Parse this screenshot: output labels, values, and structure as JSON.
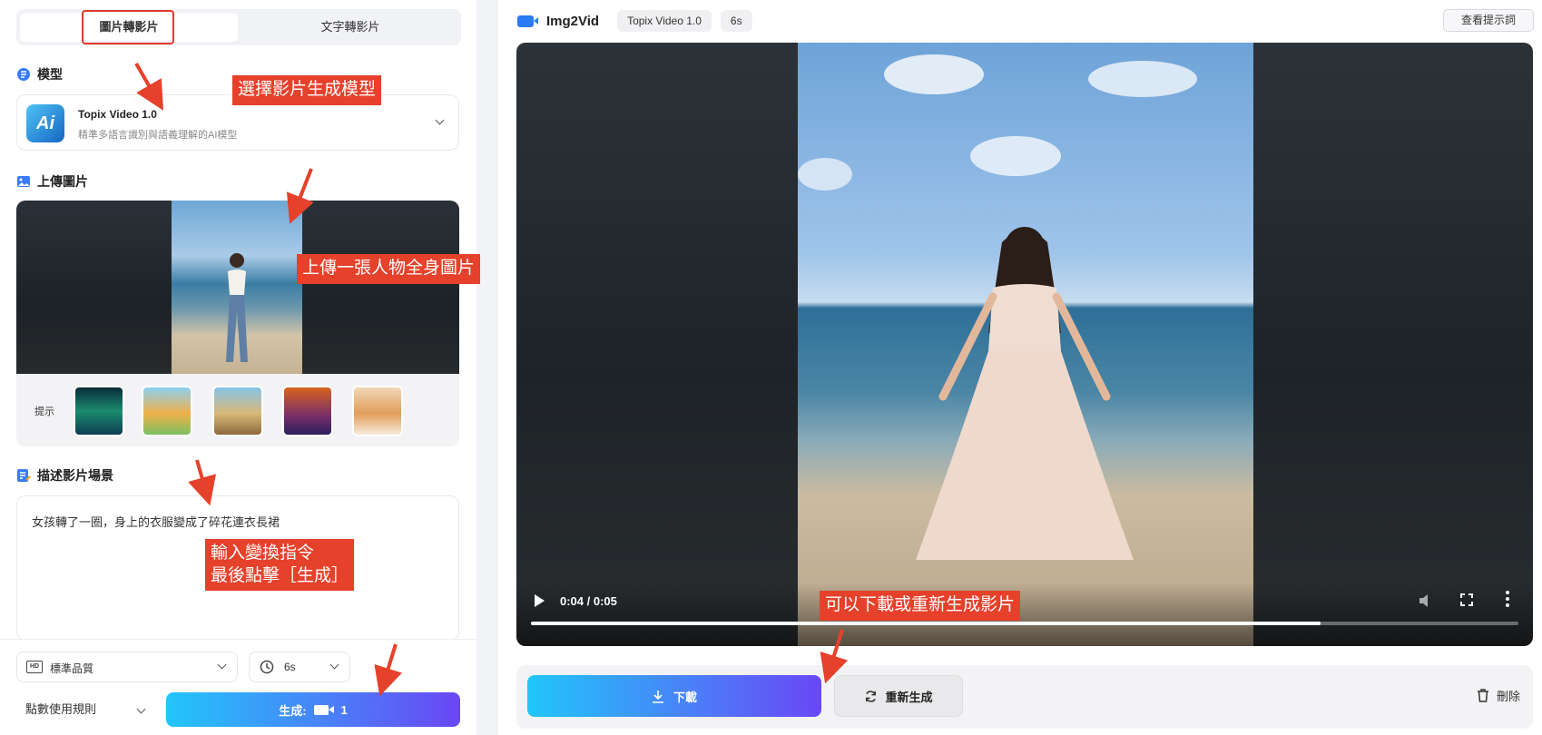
{
  "tabs": {
    "image_to_video": "圖片轉影片",
    "text_to_video": "文字轉影片"
  },
  "model_section": {
    "title": "模型",
    "name": "Topix Video 1.0",
    "description": "精準多語言識別與語義理解的AI模型",
    "logo_text": "Ai"
  },
  "upload_section": {
    "title": "上傳圖片",
    "hint_label": "提示",
    "hint_thumbnails": [
      "aurora-thumbnail",
      "cartoon-lion-thumbnail",
      "desert-horse-thumbnail",
      "robot-thumbnail",
      "kitten-thumbnail"
    ]
  },
  "description_section": {
    "title": "描述影片場景",
    "value": "女孩轉了一圈，身上的衣服變成了碎花連衣長裙"
  },
  "settings": {
    "quality": "標準品質",
    "quality_badge": "HD",
    "duration": "6s"
  },
  "footer": {
    "rules": "點數使用規則",
    "generate_label": "生成:",
    "generate_cost": "1"
  },
  "header": {
    "app_title": "Img2Vid",
    "model_chip": "Topix Video 1.0",
    "duration_chip": "6s",
    "view_prompt": "查看提示詞"
  },
  "player": {
    "time": "0:04 / 0:05",
    "progress": 0.8
  },
  "actions": {
    "download": "下載",
    "regenerate": "重新生成",
    "delete": "刪除"
  },
  "annotations": {
    "select_model": "選擇影片生成模型",
    "upload_photo": "上傳一張人物全身圖片",
    "enter_prompt_line1": "輸入變換指令",
    "enter_prompt_line2": "最後點擊［生成］",
    "download_or_regen": "可以下載或重新生成影片"
  },
  "colors": {
    "accent_start": "#22c6fb",
    "accent_end": "#6a47f5",
    "callout": "#e5412b",
    "highlight": "#e03a2f"
  }
}
